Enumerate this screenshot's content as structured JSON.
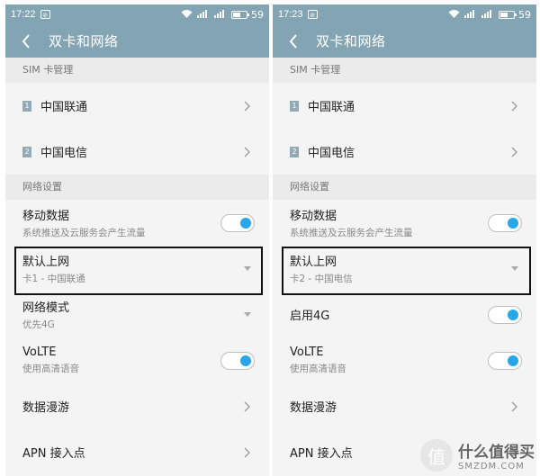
{
  "left": {
    "status": {
      "time": "17:22",
      "battery": "59"
    },
    "title": "双卡和网络",
    "sim_header": "SIM 卡管理",
    "sims": [
      {
        "badge": "1",
        "name": "中国联通"
      },
      {
        "badge": "2",
        "name": "中国电信"
      }
    ],
    "net_header": "网络设置",
    "mobile_data": {
      "label": "移动数据",
      "sub": "系统推送及云服务会产生流量",
      "on": true
    },
    "default_net": {
      "label": "默认上网",
      "sub": "卡1 - 中国联通"
    },
    "mode": {
      "label": "网络模式",
      "sub": "优先4G"
    },
    "volte": {
      "label": "VoLTE",
      "sub": "使用高清语音",
      "on": true
    },
    "roaming": "数据漫游",
    "apn": "APN 接入点"
  },
  "right": {
    "status": {
      "time": "17:23",
      "battery": "59"
    },
    "title": "双卡和网络",
    "sim_header": "SIM 卡管理",
    "sims": [
      {
        "badge": "1",
        "name": "中国联通"
      },
      {
        "badge": "2",
        "name": "中国电信"
      }
    ],
    "net_header": "网络设置",
    "mobile_data": {
      "label": "移动数据",
      "sub": "系统推送及云服务会产生流量",
      "on": true
    },
    "default_net": {
      "label": "默认上网",
      "sub": "卡2 - 中国电信"
    },
    "enable4g": {
      "label": "启用4G",
      "on": true
    },
    "volte": {
      "label": "VoLTE",
      "sub": "使用高清语音",
      "on": true
    },
    "roaming": "数据漫游",
    "apn": "APN 接入点"
  },
  "watermark": {
    "title": "什么值得买",
    "site": "SMZDM.COM"
  },
  "colors": {
    "appbar": "#83a5b3",
    "toggle_on": "#27a7e8",
    "highlight": "#111111"
  }
}
